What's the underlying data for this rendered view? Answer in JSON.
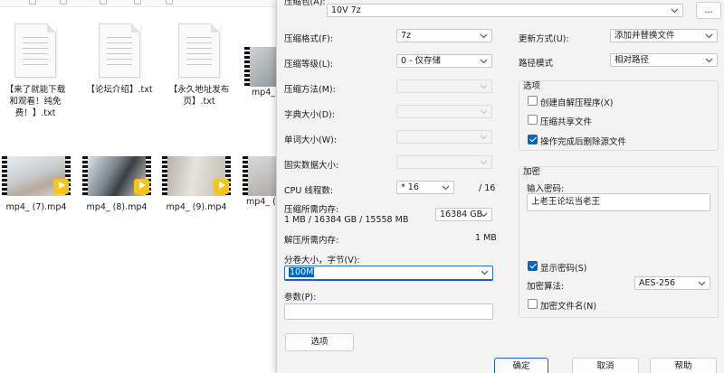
{
  "explorer": {
    "files": [
      {
        "name": "【来了就能下载和观看！纯免费！】.txt",
        "kind": "txt"
      },
      {
        "name": "【论坛介绍】.txt",
        "kind": "txt"
      },
      {
        "name": "【永久地址发布页】.txt",
        "kind": "txt"
      },
      {
        "name": "mp4_",
        "kind": "video"
      },
      {
        "name": "mp4_ (7).mp4",
        "kind": "video"
      },
      {
        "name": "mp4_ (8).mp4",
        "kind": "video"
      },
      {
        "name": "mp4_ (9).mp4",
        "kind": "video"
      },
      {
        "name": "mp4_ (",
        "kind": "video"
      }
    ],
    "badge_text": "Player",
    "badge_color": "#f5c518"
  },
  "dialog": {
    "archive_label": "压缩包(A):",
    "archive_value": "10V 7z",
    "browse_label": "...",
    "left": {
      "format_label": "压缩格式(F):",
      "format_value": "7z",
      "level_label": "压缩等级(L):",
      "level_value": "0 - 仅存储",
      "method_label": "压缩方法(M):",
      "dict_label": "字典大小(D):",
      "word_label": "单词大小(W):",
      "solid_label": "固实数据大小:",
      "threads_label": "CPU 线程数:",
      "threads_value": "* 16",
      "threads_total": "/ 16",
      "mem_comp_label": "压缩所需内存:",
      "mem_comp_detail": "1 MB / 16384 GB / 15558 MB",
      "mem_comp_value": "16384 GB",
      "mem_decomp_label": "解压所需内存:",
      "mem_decomp_value": "1 MB",
      "split_label": "分卷大小，字节(V):",
      "split_value": "100M",
      "params_label": "参数(P):",
      "params_value": "",
      "options_button": "选项"
    },
    "right": {
      "update_label": "更新方式(U):",
      "update_value": "添加并替换文件",
      "path_label": "路径模式",
      "path_value": "相对路径",
      "options_title": "选项",
      "opt_sfx": "创建自解压程序(X)",
      "opt_shared": "压缩共享文件",
      "opt_delete": "操作完成后删除源文件",
      "opt_sfx_checked": false,
      "opt_shared_checked": false,
      "opt_delete_checked": true,
      "encrypt_title": "加密",
      "password_label": "输入密码:",
      "password_value": "上老王论坛当老王",
      "show_password": "显示密码(S)",
      "show_password_checked": true,
      "enc_method_label": "加密算法:",
      "enc_method_value": "AES-256",
      "encrypt_names": "加密文件名(N)",
      "encrypt_names_checked": false
    },
    "buttons": {
      "ok": "确定",
      "cancel": "取消",
      "help": "帮助"
    }
  }
}
